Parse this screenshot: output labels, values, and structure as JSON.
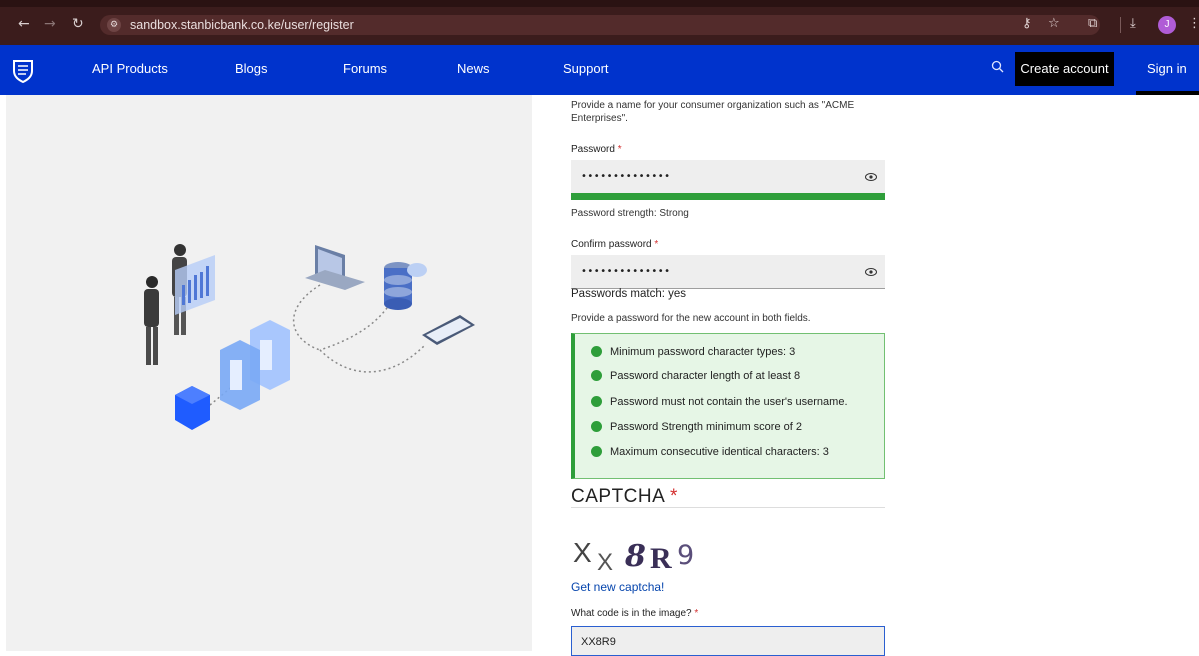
{
  "browser": {
    "url": "sandbox.stanbicbank.co.ke/user/register",
    "profile_initial": "J"
  },
  "nav": {
    "items": [
      "API Products",
      "Blogs",
      "Forums",
      "News",
      "Support"
    ],
    "create_account": "Create account",
    "sign_in": "Sign in"
  },
  "form": {
    "org_help": "Provide a name for your consumer organization such as \"ACME Enterprises\".",
    "password_label": "Password",
    "password_value": "••••••••••••••",
    "password_strength": "Password strength: Strong",
    "password_strength_level": 1.0,
    "confirm_label": "Confirm password",
    "confirm_value": "••••••••••••••",
    "match_text": "Passwords match: yes",
    "password_help": "Provide a password for the new account in both fields.",
    "required_marker": "*",
    "checks": [
      "Minimum password character types: 3",
      "Password character length of at least 8",
      "Password must not contain the user's username.",
      "Password Strength minimum score of 2",
      "Maximum consecutive identical characters: 3"
    ],
    "captcha_title": "CAPTCHA",
    "captcha_chars": [
      "X",
      "X",
      "8",
      "R",
      "9"
    ],
    "new_captcha": "Get new captcha!",
    "code_label": "What code is in the image?",
    "code_value": "XX8R9"
  },
  "colors": {
    "brand_blue": "#0033cc",
    "success_green": "#2e9e3a",
    "required_red": "#d32f2f",
    "link_blue": "#0645ad"
  },
  "icons": [
    "back-icon",
    "forward-icon",
    "reload-icon",
    "site-info-icon",
    "password-key-icon",
    "star-icon",
    "extensions-icon",
    "download-icon",
    "menu-icon",
    "stanbic-logo",
    "search-icon",
    "eye-icon",
    "check-icon"
  ]
}
